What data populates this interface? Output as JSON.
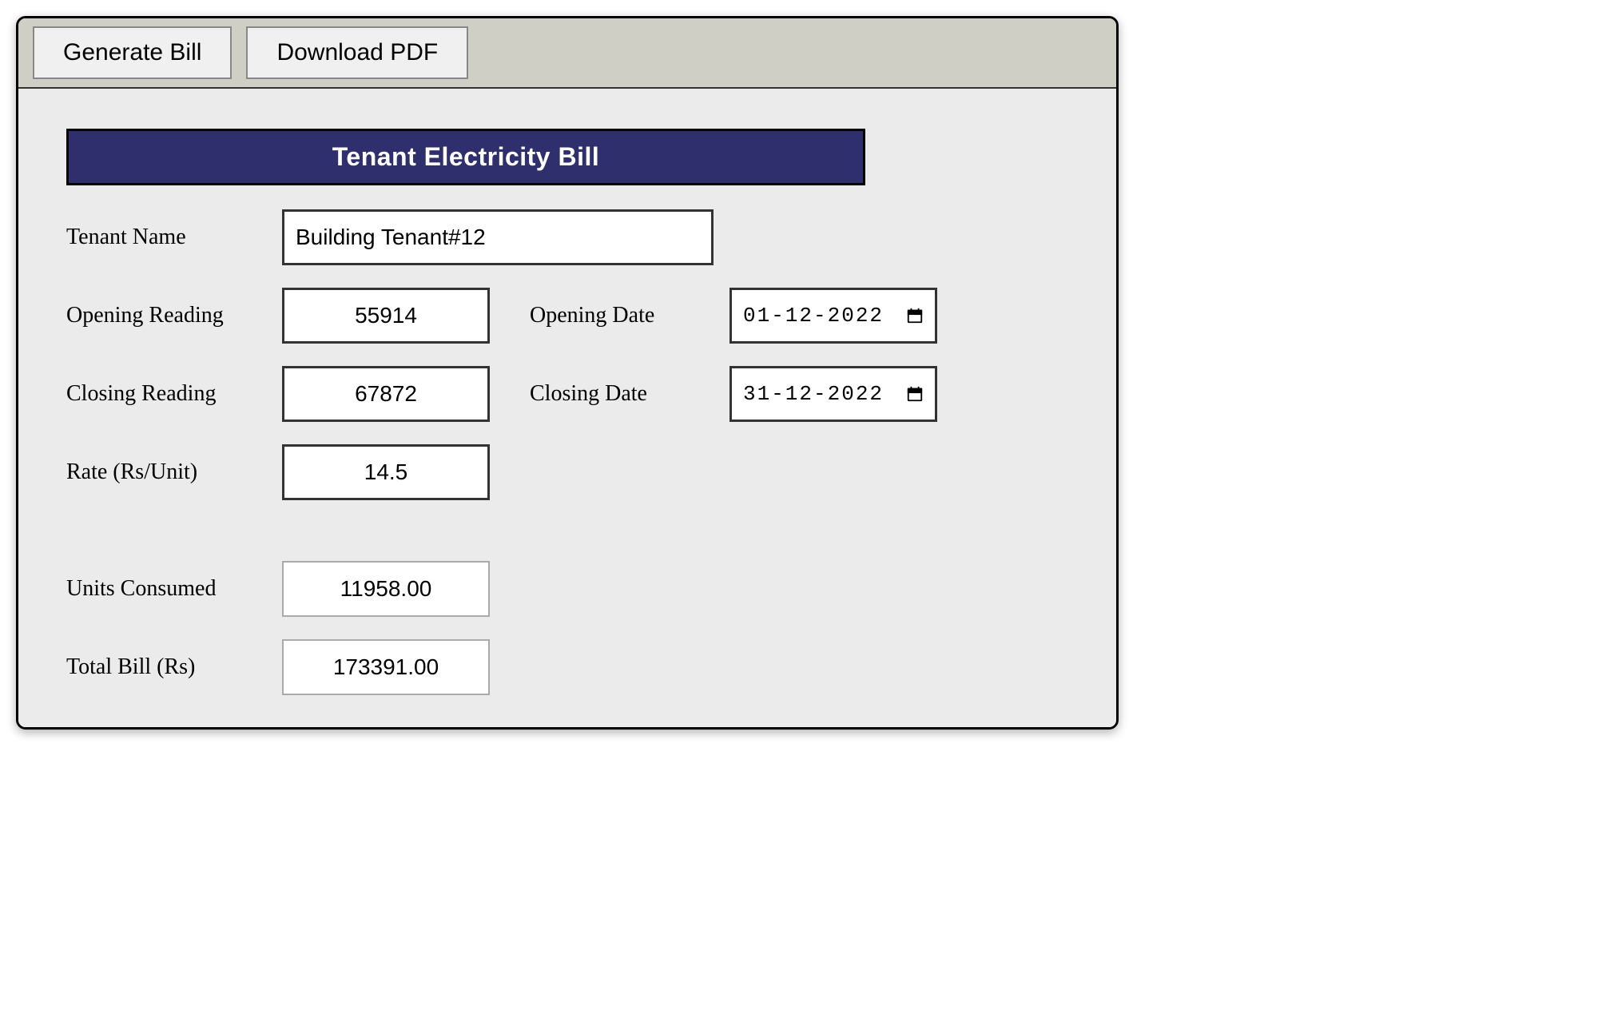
{
  "toolbar": {
    "generate_label": "Generate Bill",
    "download_label": "Download PDF"
  },
  "title": "Tenant Electricity Bill",
  "labels": {
    "tenant_name": "Tenant Name",
    "opening_reading": "Opening Reading",
    "opening_date": "Opening Date",
    "closing_reading": "Closing Reading",
    "closing_date": "Closing Date",
    "rate": "Rate (Rs/Unit)",
    "units_consumed": "Units Consumed",
    "total_bill": "Total Bill (Rs)"
  },
  "fields": {
    "tenant_name": "Building Tenant#12",
    "opening_reading": "55914",
    "opening_date": "01-12-2022",
    "closing_reading": "67872",
    "closing_date": "31-12-2022",
    "rate": "14.5",
    "units_consumed": "11958.00",
    "total_bill": "173391.00"
  }
}
